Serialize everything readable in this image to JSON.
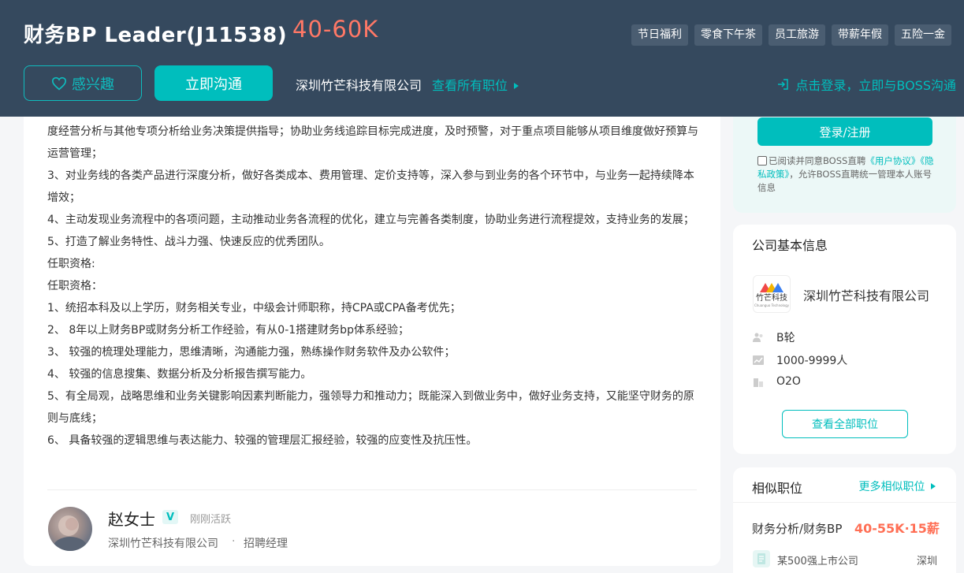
{
  "header": {
    "job_title": "财务BP Leader(J11538)",
    "salary": "40-60K",
    "tags": [
      "节日福利",
      "零食下午茶",
      "员工旅游",
      "带薪年假",
      "五险一金"
    ],
    "interest_label": "感兴趣",
    "chat_label": "立即沟通",
    "company_name": "深圳竹芒科技有限公司",
    "view_all_jobs": "查看所有职位",
    "login_prompt": "点击登录，立即与BOSS沟通"
  },
  "description": {
    "lines": [
      "度经营分析与其他专项分析给业务决策提供指导；协助业务线追踪目标完成进度，及时预警，对于重点项目能够从项目维度做好预算与运营管理；",
      "3、对业务线的各类产品进行深度分析，做好各类成本、费用管理、定价支持等，深入参与到业务的各个环节中，与业务一起持续降本增效；",
      "4、主动发现业务流程中的各项问题，主动推动业务各流程的优化，建立与完善各类制度，协助业务进行流程提效，支持业务的发展；",
      "5、打造了解业务特性、战斗力强、快速反应的优秀团队。",
      "任职资格:",
      "任职资格：",
      "1、统招本科及以上学历，财务相关专业，中级会计师职称，持CPA或CPA备考优先；",
      "2、 8年以上财务BP或财务分析工作经验，有从0-1搭建财务bp体系经验；",
      "3、 较强的梳理处理能力，思维清晰，沟通能力强，熟练操作财务软件及办公软件；",
      "4、 较强的信息搜集、数据分析及分析报告撰写能力。",
      "5、有全局观，战略思维和业务关键影响因素判断能力，强领导力和推动力；既能深入到做业务中，做好业务支持，又能坚守财务的原则与底线；",
      "6、 具备较强的逻辑思维与表达能力、较强的管理层汇报经验，较强的应变性及抗压性。"
    ]
  },
  "recruiter": {
    "name": "赵女士",
    "badge": "V",
    "status": "刚刚活跃",
    "company": "深圳竹芒科技有限公司",
    "separator": "·",
    "role": "招聘经理"
  },
  "login_card": {
    "button": "登录/注册",
    "agree_prefix": "已阅读并同意BOSS直聘",
    "user_agreement": "《用户协议》",
    "privacy_policy": "《隐私政策》",
    "agree_suffix": "，允许BOSS直聘统一管理本人账号信息"
  },
  "company_info": {
    "title": "公司基本信息",
    "name": "深圳竹芒科技有限公司",
    "logo_text": "竹芒科技",
    "logo_sub": "Chuanguo Technology",
    "funding": "B轮",
    "size": "1000-9999人",
    "industry": "O2O",
    "view_all": "查看全部职位"
  },
  "similar": {
    "title": "相似职位",
    "more": "更多相似职位",
    "job_name": "财务分析/财务BP",
    "job_salary": "40-55K·15薪",
    "company": "某500强上市公司",
    "city": "深圳"
  },
  "colors": {
    "header_bg": "#35495e",
    "accent": "#00bebd",
    "salary": "#ff7866"
  }
}
